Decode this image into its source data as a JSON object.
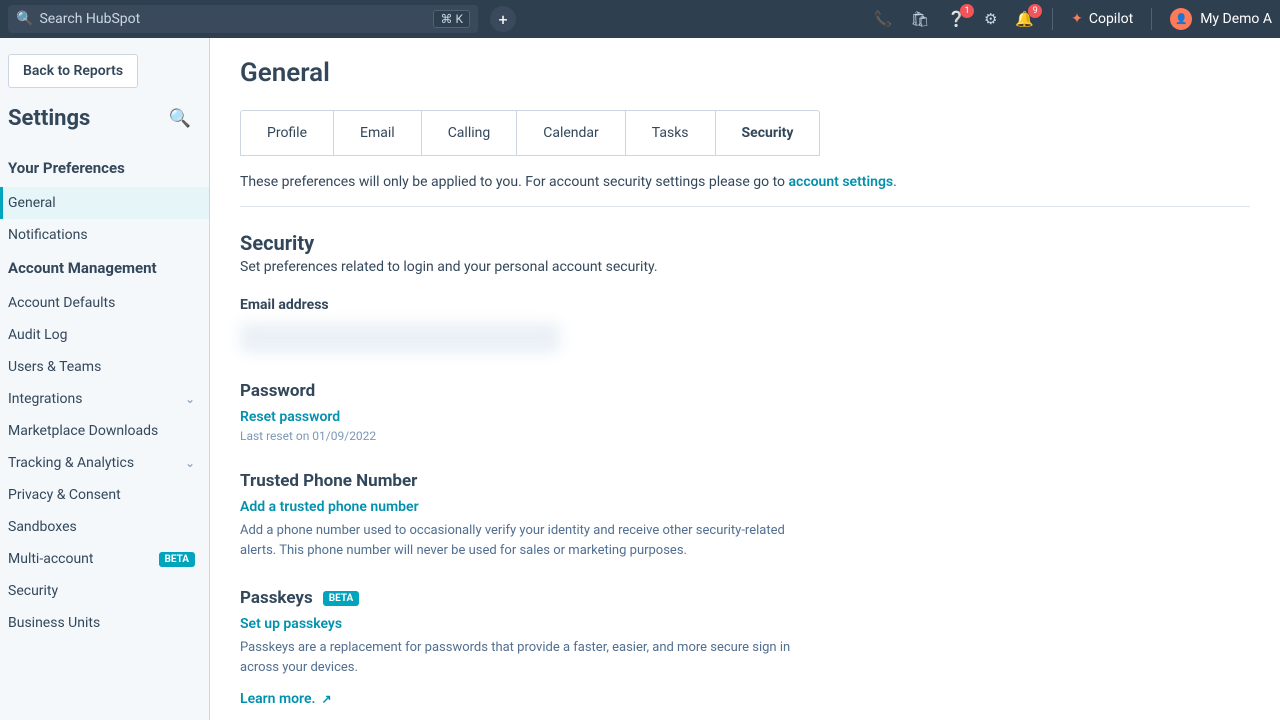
{
  "topbar": {
    "search_placeholder": "Search HubSpot",
    "shortcut": "⌘ K",
    "copilot_label": "Copilot",
    "account_label": "My Demo A",
    "badge_help": "1",
    "badge_notif": "9"
  },
  "sidebar": {
    "back_label": "Back to Reports",
    "title": "Settings",
    "sections": [
      {
        "heading": "Your Preferences",
        "items": [
          {
            "label": "General",
            "active": true
          },
          {
            "label": "Notifications"
          }
        ]
      },
      {
        "heading": "Account Management",
        "items": [
          {
            "label": "Account Defaults"
          },
          {
            "label": "Audit Log"
          },
          {
            "label": "Users & Teams"
          },
          {
            "label": "Integrations",
            "chevron": true
          },
          {
            "label": "Marketplace Downloads"
          },
          {
            "label": "Tracking & Analytics",
            "chevron": true
          },
          {
            "label": "Privacy & Consent"
          },
          {
            "label": "Sandboxes"
          },
          {
            "label": "Multi-account",
            "beta": "BETA"
          },
          {
            "label": "Security"
          },
          {
            "label": "Business Units"
          }
        ]
      }
    ]
  },
  "main": {
    "title": "General",
    "tabs": [
      "Profile",
      "Email",
      "Calling",
      "Calendar",
      "Tasks",
      "Security"
    ],
    "active_tab": "Security",
    "notice_pre": "These preferences will only be applied to you. For account security settings please go to ",
    "notice_link": "account settings",
    "notice_post": ".",
    "security": {
      "heading": "Security",
      "desc": "Set preferences related to login and your personal account security.",
      "email_label": "Email address",
      "password_heading": "Password",
      "reset_link": "Reset password",
      "reset_meta": "Last reset on 01/09/2022",
      "phone_heading": "Trusted Phone Number",
      "phone_link": "Add a trusted phone number",
      "phone_desc": "Add a phone number used to occasionally verify your identity and receive other security-related alerts. This phone number will never be used for sales or marketing purposes.",
      "passkeys_heading": "Passkeys",
      "passkeys_badge": "BETA",
      "passkeys_link": "Set up passkeys",
      "passkeys_desc": "Passkeys are a replacement for passwords that provide a faster, easier, and more secure sign in across your devices.",
      "learn_more": "Learn more."
    }
  }
}
